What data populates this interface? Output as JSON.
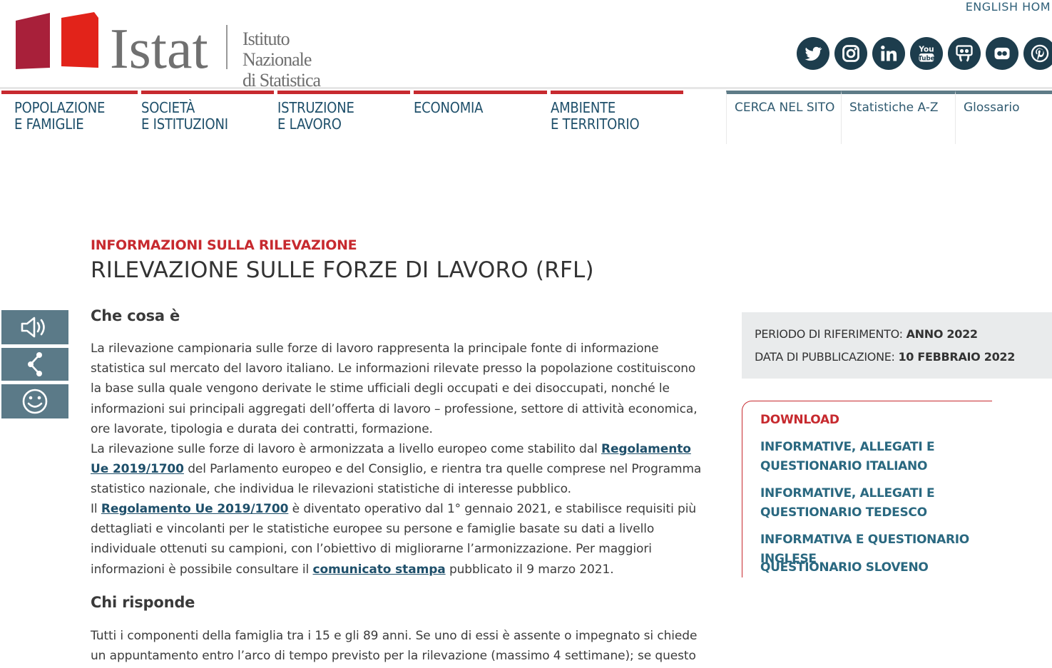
{
  "header": {
    "lang_link": "ENGLISH HOM",
    "logo_word": "Istat",
    "logo_subtitle_line1": "Istituto Nazionale",
    "logo_subtitle_line2": "di Statistica",
    "social_icons": [
      "twitter-icon",
      "instagram-icon",
      "linkedin-icon",
      "youtube-icon",
      "slideshare-icon",
      "flickr-icon",
      "pinterest-icon"
    ]
  },
  "nav": {
    "items": [
      {
        "label": "POPOLAZIONE\nE FAMIGLIE"
      },
      {
        "label": "SOCIETÀ\nE ISTITUZIONI"
      },
      {
        "label": "ISTRUZIONE\nE LAVORO"
      },
      {
        "label": "ECONOMIA"
      },
      {
        "label": "AMBIENTE\nE TERRITORIO"
      }
    ],
    "utility": [
      {
        "label": "CERCA NEL SITO"
      },
      {
        "label": "Statistiche A-Z"
      },
      {
        "label": "Glossario"
      }
    ]
  },
  "content": {
    "eyebrow": "INFORMAZIONI SULLA RILEVAZIONE",
    "title": "RILEVAZIONE SULLE FORZE DI LAVORO (RFL)",
    "section1_heading": "Che cosa è",
    "p1": "La rilevazione campionaria sulle forze di lavoro rappresenta la principale fonte di informazione statistica sul mercato del lavoro italiano. Le informazioni rilevate presso la popolazione costituiscono la base sulla quale vengono derivate le stime ufficiali degli occupati e dei disoccupati, nonché le informazioni sui principali aggregati dell’offerta di lavoro – professione, settore di attività economica, ore lavorate, tipologia e durata dei contratti, formazione.",
    "p2_before": "La rilevazione sulle forze di lavoro è armonizzata a livello europeo come stabilito dal ",
    "p2_link": "Regolamento Ue 2019/1700",
    "p2_after": " del Parlamento europeo e del Consiglio, e rientra tra quelle comprese nel Programma statistico nazionale, che individua le rilevazioni statistiche di interesse pubblico.",
    "p3_before": "Il ",
    "p3_link": "Regolamento Ue 2019/1700",
    "p3_middle": " è diventato operativo dal 1° gennaio 2021, e stabilisce requisiti più dettagliati e vincolanti per le statistiche europee su persone e famiglie basate su dati a livello individuale ottenuti su campioni, con l’obiettivo di migliorarne l’armonizzazione. Per maggiori informazioni è possibile consultare il ",
    "p3_link2": "comunicato stampa",
    "p3_after": " pubblicato il 9 marzo 2021.",
    "section2_heading": "Chi risponde",
    "p4": "Tutti i componenti della famiglia tra i 15 e gli 89 anni. Se uno di essi è assente o impegnato si chiede un appuntamento entro l’arco di tempo previsto per la rilevazione (massimo 4 settimane); se questo"
  },
  "tools": [
    "speaker-icon",
    "share-icon",
    "smiley-icon"
  ],
  "sidebar": {
    "period_label": "PERIODO DI RIFERIMENTO:",
    "period_value": "ANNO 2022",
    "pub_label": "DATA DI PUBBLICAZIONE:",
    "pub_value": "10 FEBBRAIO 2022",
    "download_title": "DOWNLOAD",
    "downloads": [
      "INFORMATIVE, ALLEGATI E QUESTIONARIO ITALIANO",
      "INFORMATIVE, ALLEGATI E QUESTIONARIO TEDESCO",
      "INFORMATIVA E QUESTIONARIO INGLESE",
      "QUESTIONARIO SLOVENO"
    ]
  },
  "colors": {
    "brand_red": "#c72a2f",
    "navy": "#1e4f6a",
    "tool_bg": "#5b7a88"
  }
}
